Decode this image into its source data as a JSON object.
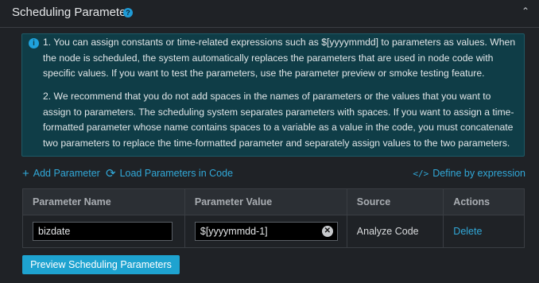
{
  "section": {
    "title": "Scheduling Parameter",
    "help_icon": "question-circle-icon",
    "collapse_icon": "chevron-up-icon"
  },
  "notice": {
    "icon": "info-circle-icon",
    "paragraph1": "1. You can assign constants or time-related expressions such as $[yyyymmdd] to parameters as values. When the node is scheduled, the system automatically replaces the parameters that are used in node code with specific values. If you want to test the parameters, use the parameter preview or smoke testing feature.",
    "paragraph2": "2. We recommend that you do not add spaces in the names of parameters or the values that you want to assign to parameters. The scheduling system separates parameters with spaces. If you want to assign a time-formatted parameter whose name contains spaces to a variable as a value in the code, you must concatenate two parameters to replace the time-formatted parameter and separately assign values to the two parameters."
  },
  "toolbar": {
    "add_label": "Add Parameter",
    "load_label": "Load Parameters in Code",
    "expression_label": "Define by expression"
  },
  "table": {
    "columns": [
      "Parameter Name",
      "Parameter Value",
      "Source",
      "Actions"
    ],
    "rows": [
      {
        "name": "bizdate",
        "value": "$[yyyymmdd-1]",
        "source": "Analyze Code",
        "action": "Delete"
      }
    ]
  },
  "preview_button": "Preview Scheduling Parameters",
  "colors": {
    "background": "#1f2226",
    "accent": "#31a8d8",
    "notice_bg": "#0f3d47",
    "button_bg": "#1ea3d0"
  }
}
